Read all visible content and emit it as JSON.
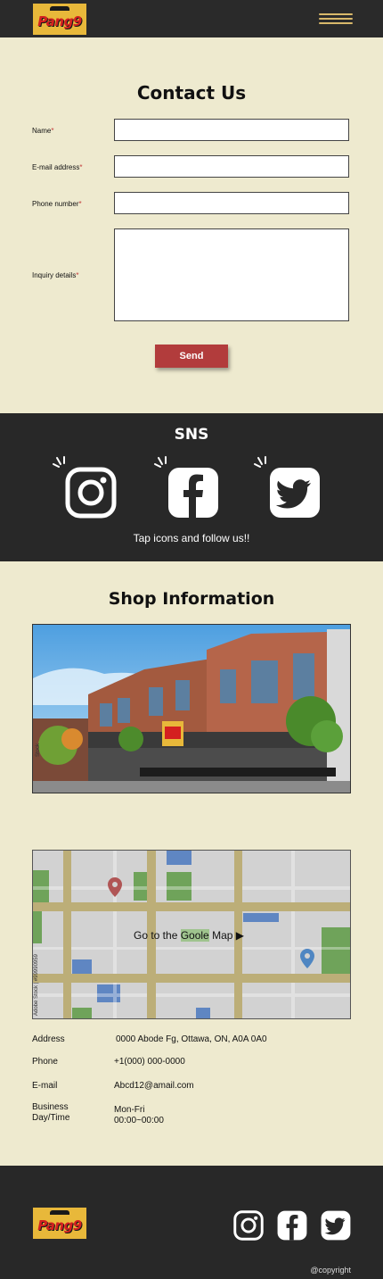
{
  "header": {
    "logo_text": "Pang9",
    "menu_icon": "hamburger-menu-icon"
  },
  "contact": {
    "title": "Contact Us",
    "fields": [
      {
        "label": "Name",
        "required_mark": "*",
        "value": ""
      },
      {
        "label": "E-mail address",
        "required_mark": "*",
        "value": ""
      },
      {
        "label": "Phone number",
        "required_mark": "*",
        "value": ""
      },
      {
        "label": "Inquiry details",
        "required_mark": "*",
        "value": ""
      }
    ],
    "send_label": "Send"
  },
  "sns": {
    "title": "SNS",
    "icons": [
      "instagram-icon",
      "facebook-icon",
      "twitter-icon"
    ],
    "caption": "Tap icons and follow us!!"
  },
  "shop": {
    "title": "Shop Information",
    "map_link_prefix": "Go to the ",
    "map_link_highlight": "Goole",
    "map_link_suffix": " Map",
    "map_link_arrow": "▶",
    "watermark": "Adobe Stock | #99990959",
    "info": [
      {
        "label": "Address",
        "value": "0000 Abode Fg, Ottawa, ON, A0A 0A0"
      },
      {
        "label": "Phone",
        "value": "+1(000) 000-0000"
      },
      {
        "label": "E-mail",
        "value": "Abcd12@amail.com"
      },
      {
        "label": "Business Day/Time",
        "value": "Mon-Fri\n00:00~00:00"
      }
    ]
  },
  "footer": {
    "logo_text": "Pang9",
    "copyright": "@copyright"
  },
  "colors": {
    "dark": "#282828",
    "cream": "#eeeacf",
    "accent_red": "#b23c3c",
    "logo_yellow": "#e8b83a"
  }
}
